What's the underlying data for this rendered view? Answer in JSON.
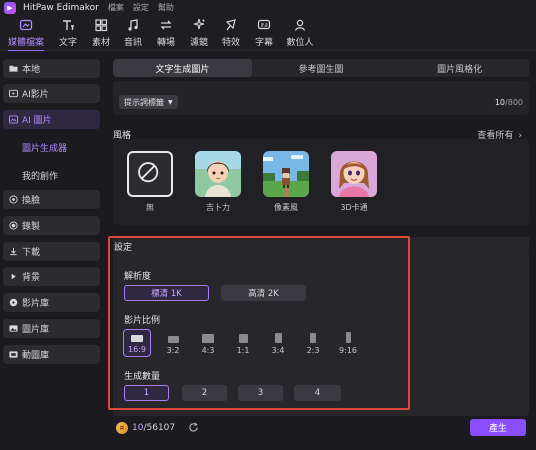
{
  "app": {
    "title": "HitPaw Edimakor",
    "menu": [
      "檔案",
      "設定",
      "幫助"
    ]
  },
  "toolbar": [
    {
      "label": "媒體檔案",
      "icon": "media-icon",
      "active": true
    },
    {
      "label": "文字",
      "icon": "text-icon"
    },
    {
      "label": "素材",
      "icon": "material-icon"
    },
    {
      "label": "音訊",
      "icon": "audio-icon"
    },
    {
      "label": "轉場",
      "icon": "transition-icon"
    },
    {
      "label": "濾鏡",
      "icon": "filter-icon"
    },
    {
      "label": "特效",
      "icon": "effects-icon"
    },
    {
      "label": "字幕",
      "icon": "subtitle-icon"
    },
    {
      "label": "數位人",
      "icon": "avatar-icon"
    }
  ],
  "sidebar": {
    "items": [
      {
        "label": "本地",
        "icon": "folder-icon"
      },
      {
        "label": "AI影片",
        "icon": "ai-video-icon"
      },
      {
        "label": "AI 圖片",
        "icon": "ai-image-icon",
        "active": true
      }
    ],
    "sub_items": [
      {
        "label": "圖片生成器",
        "active": true
      },
      {
        "label": "我的創作"
      }
    ],
    "items2": [
      {
        "label": "換臉",
        "icon": "face-swap-icon"
      },
      {
        "label": "錄製",
        "icon": "record-icon"
      },
      {
        "label": "下載",
        "icon": "download-icon"
      },
      {
        "label": "背景",
        "icon": "background-icon"
      },
      {
        "label": "影片庫",
        "icon": "video-library-icon"
      },
      {
        "label": "圖片庫",
        "icon": "image-library-icon"
      },
      {
        "label": "動圖庫",
        "icon": "gif-library-icon"
      }
    ]
  },
  "tabs": [
    {
      "label": "文字生成圖片",
      "active": true
    },
    {
      "label": "參考圖生圖"
    },
    {
      "label": "圖片風格化"
    }
  ],
  "prompt": {
    "tag_button": "提示詞標籤",
    "count_used": "10",
    "count_max": "/800"
  },
  "style_section": {
    "title": "風格",
    "view_all": "查看所有",
    "items": [
      {
        "label": "無",
        "icon": "none-icon",
        "selected": true
      },
      {
        "label": "吉卜力"
      },
      {
        "label": "像素風"
      },
      {
        "label": "3D卡通"
      }
    ]
  },
  "settings": {
    "title": "設定",
    "resolution": {
      "label": "解析度",
      "options": [
        "標清 1K",
        "高清 2K"
      ],
      "selected": 0
    },
    "ratio": {
      "label": "影片比例",
      "options": [
        "16:9",
        "3:2",
        "4:3",
        "1:1",
        "3:4",
        "2:3",
        "9:16"
      ],
      "selected": 0
    },
    "count": {
      "label": "生成數量",
      "options": [
        "1",
        "2",
        "3",
        "4"
      ],
      "selected": 0
    }
  },
  "bottom": {
    "credits_used": "10",
    "credits_total": "/56107",
    "generate_label": "產生"
  },
  "colors": {
    "accent": "#9b6cff",
    "button": "#8a4dff",
    "highlight_box": "#e0483e"
  }
}
